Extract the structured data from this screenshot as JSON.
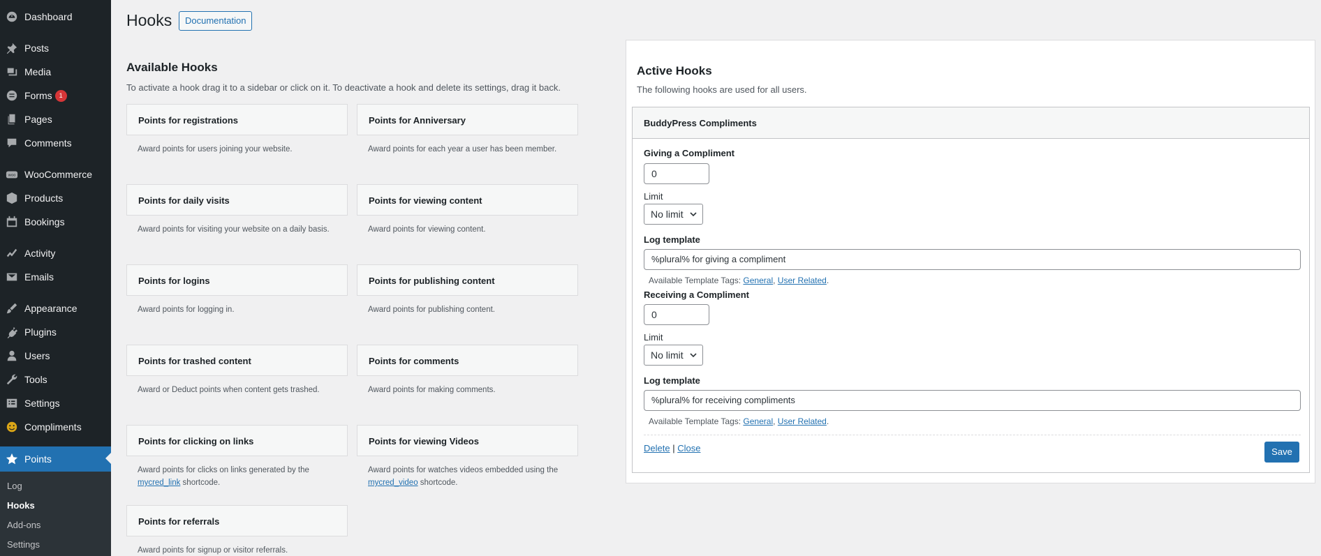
{
  "sidebar": {
    "items": [
      {
        "label": "Dashboard",
        "icon": "dashboard-icon"
      },
      {
        "label": "Posts",
        "icon": "pin-icon"
      },
      {
        "label": "Media",
        "icon": "media-icon"
      },
      {
        "label": "Forms",
        "icon": "forms-icon",
        "badge": "1"
      },
      {
        "label": "Pages",
        "icon": "pages-icon"
      },
      {
        "label": "Comments",
        "icon": "comment-icon"
      },
      {
        "label": "WooCommerce",
        "icon": "woo-icon"
      },
      {
        "label": "Products",
        "icon": "box-icon"
      },
      {
        "label": "Bookings",
        "icon": "calendar-icon"
      },
      {
        "label": "Activity",
        "icon": "activity-icon"
      },
      {
        "label": "Emails",
        "icon": "mail-icon"
      },
      {
        "label": "Appearance",
        "icon": "brush-icon"
      },
      {
        "label": "Plugins",
        "icon": "plug-icon"
      },
      {
        "label": "Users",
        "icon": "user-icon"
      },
      {
        "label": "Tools",
        "icon": "wrench-icon"
      },
      {
        "label": "Settings",
        "icon": "settings-icon"
      },
      {
        "label": "Compliments",
        "icon": "smiley-icon"
      },
      {
        "label": "Points",
        "icon": "star-icon"
      }
    ],
    "submenu": [
      "Log",
      "Hooks",
      "Add-ons",
      "Settings"
    ]
  },
  "page": {
    "title": "Hooks",
    "doc_button": "Documentation",
    "available_title": "Available Hooks",
    "available_intro": "To activate a hook drag it to a sidebar or click on it. To deactivate a hook and delete its settings, drag it back."
  },
  "hooks": [
    {
      "title": "Points for registrations",
      "desc": "Award points for users joining your website."
    },
    {
      "title": "Points for Anniversary",
      "desc": "Award points for each year a user has been member."
    },
    {
      "title": "Points for daily visits",
      "desc": "Award points for visiting your website on a daily basis."
    },
    {
      "title": "Points for viewing content",
      "desc": "Award points for viewing content."
    },
    {
      "title": "Points for logins",
      "desc": "Award points for logging in."
    },
    {
      "title": "Points for publishing content",
      "desc": "Award points for publishing content."
    },
    {
      "title": "Points for trashed content",
      "desc": "Award or Deduct points when content gets trashed."
    },
    {
      "title": "Points for comments",
      "desc": "Award points for making comments."
    },
    {
      "title": "Points for clicking on links",
      "desc_pre": "Award points for clicks on links generated by the ",
      "desc_link": "mycred_link",
      "desc_post": " shortcode."
    },
    {
      "title": "Points for viewing Videos",
      "desc_pre": "Award points for watches videos embedded using the ",
      "desc_link": "mycred_video",
      "desc_post": " shortcode."
    },
    {
      "title": "Points for referrals",
      "desc": "Award points for signup or visitor referrals."
    }
  ],
  "active": {
    "title": "Active Hooks",
    "subtitle": "The following hooks are used for all users.",
    "widget_title": "BuddyPress Compliments",
    "giving": {
      "label": "Giving a Compliment",
      "value": "0",
      "limit_label": "Limit",
      "limit_value": "No limit",
      "log_label": "Log template",
      "log_value": "%plural% for giving a compliment"
    },
    "receiving": {
      "label": "Receiving a Compliment",
      "value": "0",
      "limit_label": "Limit",
      "limit_value": "No limit",
      "log_label": "Log template",
      "log_value": "%plural% for receiving compliments"
    },
    "tags_prefix": "Available Template Tags: ",
    "tag_general": "General",
    "tag_sep": ", ",
    "tag_user": "User Related",
    "tag_end": ".",
    "delete": "Delete",
    "link_sep": " | ",
    "close": "Close",
    "save": "Save"
  },
  "colors": {
    "sidebar_bg": "#1d2327",
    "accent": "#2271b1",
    "badge": "#d63638"
  }
}
